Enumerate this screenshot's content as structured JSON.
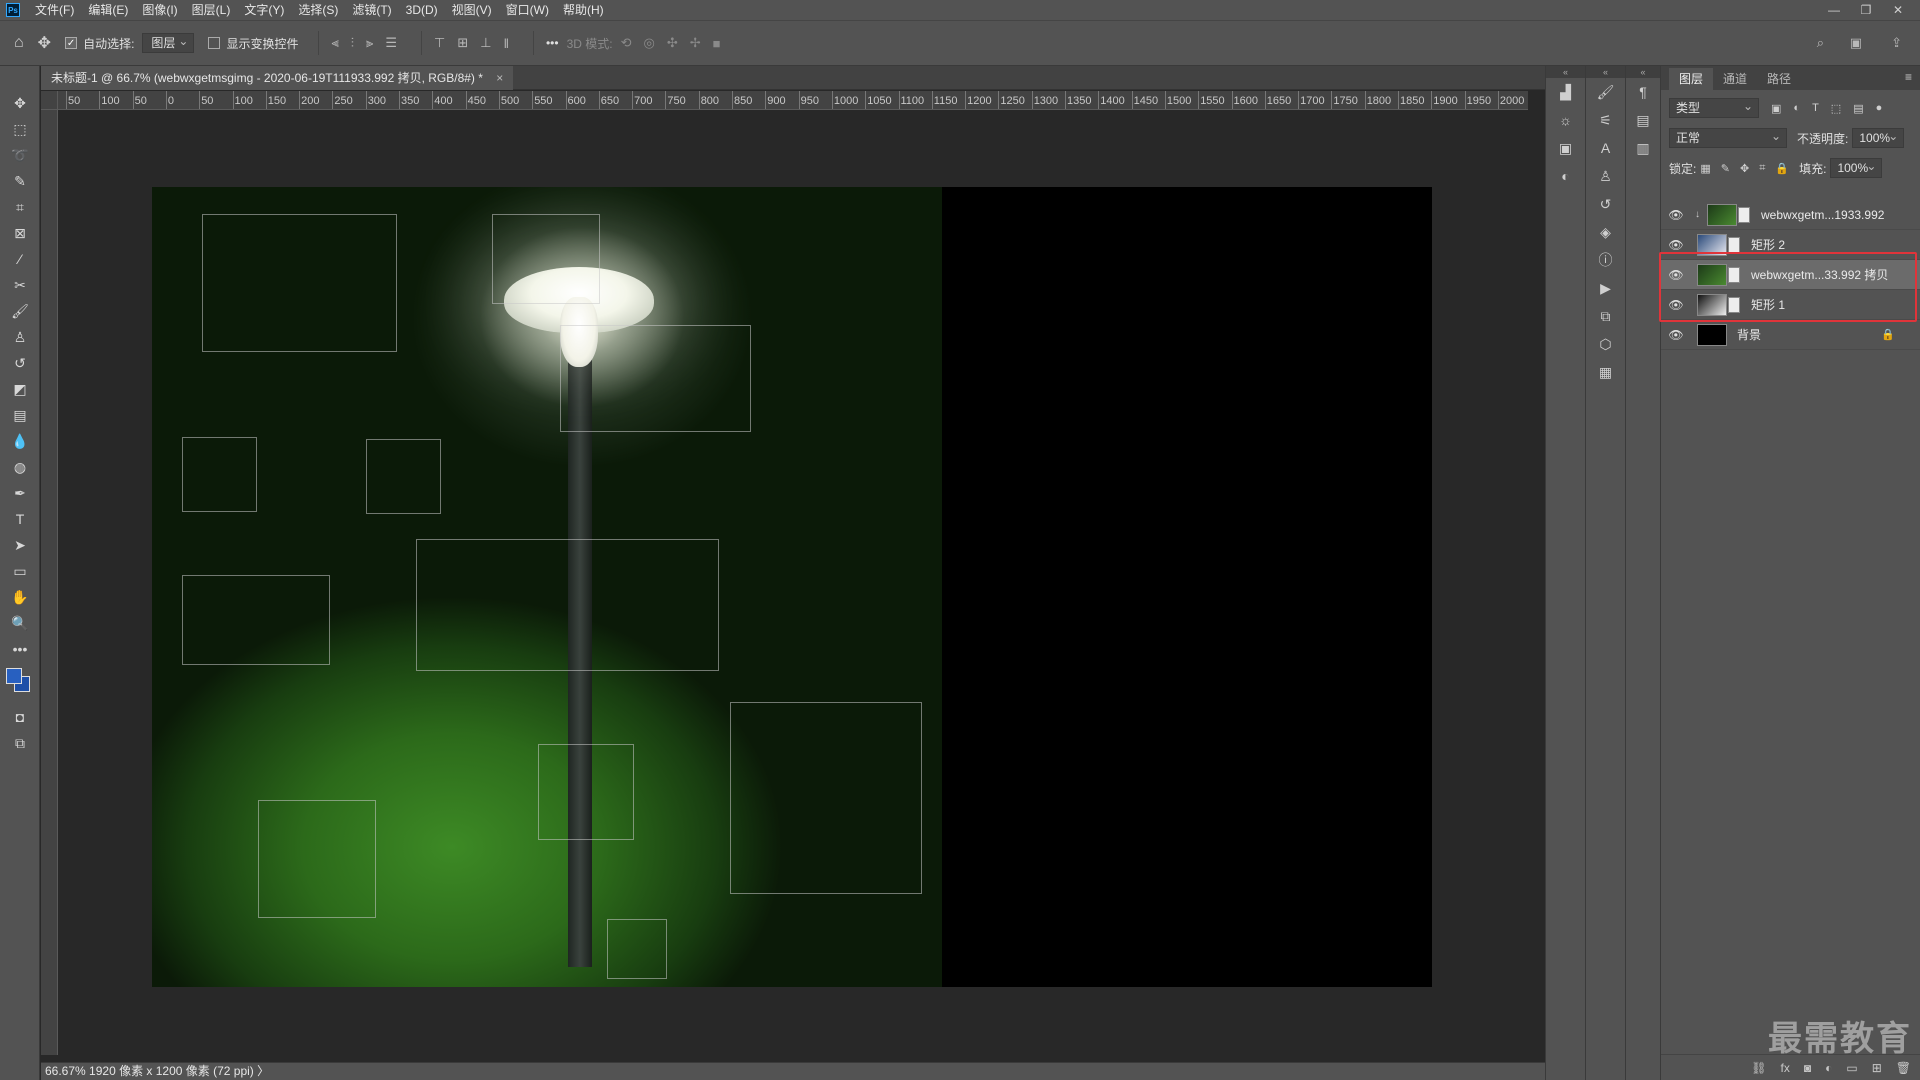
{
  "app": {
    "logo": "Ps"
  },
  "menu": [
    "文件(F)",
    "编辑(E)",
    "图像(I)",
    "图层(L)",
    "文字(Y)",
    "选择(S)",
    "滤镜(T)",
    "3D(D)",
    "视图(V)",
    "窗口(W)",
    "帮助(H)"
  ],
  "window_controls": {
    "minimize": "—",
    "restore": "❐",
    "close": "✕"
  },
  "options": {
    "auto_select_label": "自动选择:",
    "auto_select_checked": true,
    "auto_select_target": "图层",
    "show_transform_label": "显示变换控件",
    "show_transform_checked": false,
    "more": "•••",
    "mode_3d_label": "3D 模式:"
  },
  "document": {
    "tab_title": "未标题-1 @ 66.7% (webwxgetmsgimg - 2020-06-19T111933.992 拷贝, RGB/8#) *",
    "close": "×"
  },
  "ruler_h": [
    "50",
    "100",
    "50",
    "0",
    "50",
    "100",
    "150",
    "200",
    "250",
    "300",
    "350",
    "400",
    "450",
    "500",
    "550",
    "600",
    "650",
    "700",
    "750",
    "800",
    "850",
    "900",
    "950",
    "1000",
    "1050",
    "1100",
    "1150",
    "1200",
    "1250",
    "1300",
    "1350",
    "1400",
    "1450",
    "1500",
    "1550",
    "1600",
    "1650",
    "1700",
    "1750",
    "1800",
    "1850",
    "1900",
    "1950",
    "2000"
  ],
  "layers_panel": {
    "tabs": [
      "图层",
      "通道",
      "路径"
    ],
    "filter_kind": "类型",
    "blend_mode": "正常",
    "opacity_label": "不透明度:",
    "opacity_value": "100%",
    "lock_label": "锁定:",
    "fill_label": "填充:",
    "fill_value": "100%",
    "layers": [
      {
        "name": "webwxgetm...1933.992",
        "visible": true,
        "selected": false,
        "clipped": true,
        "has_mask": true,
        "locked": false
      },
      {
        "name": "矩形 2",
        "visible": true,
        "selected": false,
        "clipped": false,
        "has_mask": true,
        "locked": false
      },
      {
        "name": "webwxgetm...33.992 拷贝",
        "visible": true,
        "selected": true,
        "clipped": false,
        "has_mask": true,
        "locked": false
      },
      {
        "name": "矩形 1",
        "visible": true,
        "selected": false,
        "clipped": false,
        "has_mask": true,
        "locked": false
      },
      {
        "name": "背景",
        "visible": true,
        "selected": false,
        "clipped": false,
        "has_mask": false,
        "locked": true
      }
    ],
    "footer_icons": [
      "link-icon",
      "fx-icon",
      "mask-icon",
      "adjustment-icon",
      "folder-icon",
      "new-layer-icon",
      "trash-icon"
    ]
  },
  "status": {
    "zoom": "66.67%",
    "info": "1920 像素 x 1200 像素 (72 ppi)",
    "arrow": "〉"
  },
  "watermark": "最需教育",
  "colors": {
    "foreground": "#2860c0",
    "background": "#1d4fa8",
    "highlight": "#e0343a"
  }
}
